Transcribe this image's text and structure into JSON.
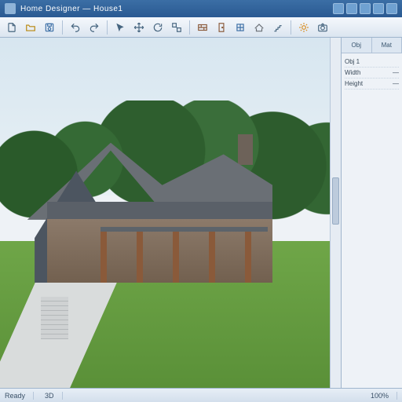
{
  "titlebar": {
    "app_title": "Home Designer — House1"
  },
  "toolbar": {
    "groups": [
      [
        "new",
        "open",
        "save"
      ],
      [
        "undo",
        "redo"
      ],
      [
        "select",
        "move",
        "rotate",
        "scale"
      ],
      [
        "wall",
        "door",
        "window",
        "roof",
        "stairs"
      ],
      [
        "render",
        "camera"
      ]
    ],
    "icons": {
      "new": "file-icon",
      "open": "folder-open-icon",
      "save": "disk-icon",
      "undo": "undo-icon",
      "redo": "redo-icon",
      "select": "cursor-icon",
      "move": "move-icon",
      "rotate": "rotate-icon",
      "scale": "scale-icon",
      "wall": "wall-icon",
      "door": "door-icon",
      "window": "window-icon",
      "roof": "roof-icon",
      "stairs": "stairs-icon",
      "render": "sun-icon",
      "camera": "camera-icon"
    }
  },
  "properties": {
    "tabs": [
      "Obj",
      "Mat"
    ],
    "rows": [
      {
        "k": "Obj 1",
        "v": ""
      },
      {
        "k": "Width",
        "v": "—"
      },
      {
        "k": "Height",
        "v": "—"
      }
    ]
  },
  "statusbar": {
    "left": "Ready",
    "view": "3D",
    "zoom": "100%"
  },
  "colors": {
    "titlebar": "#2f6199",
    "accent": "#6fa1d1"
  }
}
